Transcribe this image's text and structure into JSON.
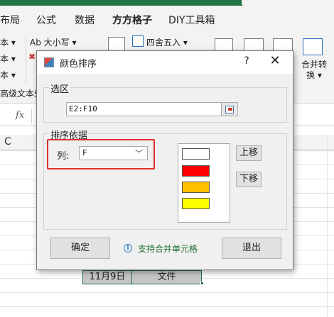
{
  "app": {
    "tabs": [
      "布局",
      "公式",
      "数据",
      "方方格子",
      "DIY工具箱"
    ],
    "active_tab": "方方格子",
    "ribbon": {
      "row1_left": "本 ▾",
      "row2_left": "本 ▾",
      "row3_left": "本 ▾",
      "font_size_btn": "Ab 大小写 ▾",
      "round_btn": "四舍五入 ▾",
      "merge_btn": "合并转换 ▾",
      "group_label": "高级文本处"
    },
    "formula_bar": {
      "fx": "fx"
    },
    "column_header": "C",
    "cells": {
      "date": "11月9日",
      "file": "文件"
    }
  },
  "dialog": {
    "title": "颜色排序",
    "help": "?",
    "close": "✕",
    "range_group_label": "选区",
    "range_value": "E2:F10",
    "sort_group_label": "排序依据",
    "column_label": "列:",
    "column_value": "F",
    "swatches": [
      {
        "color": "#ffffff"
      },
      {
        "color": "#ff0000"
      },
      {
        "color": "#ffc000"
      },
      {
        "color": "#ffff00"
      }
    ],
    "move_up": "上移",
    "move_down": "下移",
    "ok": "确定",
    "info_text": "支持合并单元格",
    "exit": "退出"
  }
}
